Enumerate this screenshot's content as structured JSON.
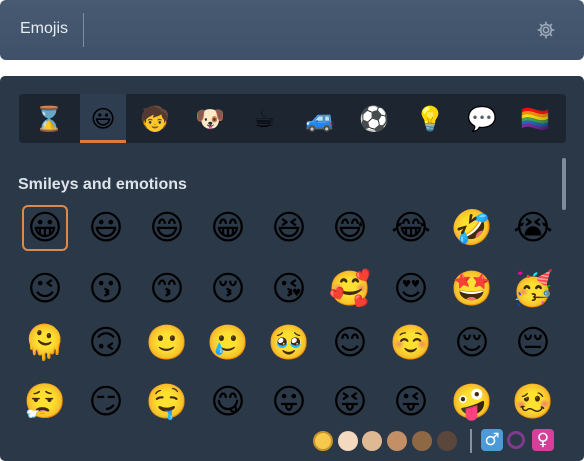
{
  "header": {
    "title": "Emojis",
    "settings_icon": "gear-icon"
  },
  "tabs": [
    {
      "name": "recent",
      "glyph": "⌛"
    },
    {
      "name": "smileys",
      "glyph": "😃",
      "active": true
    },
    {
      "name": "people",
      "glyph": "🧒"
    },
    {
      "name": "animals",
      "glyph": "🐶"
    },
    {
      "name": "food",
      "glyph": "☕"
    },
    {
      "name": "travel",
      "glyph": "🚙"
    },
    {
      "name": "activities",
      "glyph": "⚽"
    },
    {
      "name": "objects",
      "glyph": "💡"
    },
    {
      "name": "symbols",
      "glyph": "💬"
    },
    {
      "name": "flags",
      "glyph": "🏳️‍🌈"
    }
  ],
  "section": {
    "title": "Smileys and emotions"
  },
  "emojis": [
    [
      "😀",
      "😃",
      "😄",
      "😁",
      "😆",
      "😅",
      "😂",
      "🤣",
      "😭"
    ],
    [
      "😉",
      "😗",
      "😙",
      "😚",
      "😘",
      "🥰",
      "😍",
      "🤩",
      "🥳"
    ],
    [
      "🫠",
      "🙃",
      "🙂",
      "🥲",
      "🥹",
      "😊",
      "☺️",
      "😌",
      "😔"
    ],
    [
      "😮‍💨",
      "😏",
      "🤤",
      "😋",
      "😛",
      "😝",
      "😜",
      "🤪",
      "🥴"
    ]
  ],
  "skin_tones": [
    {
      "name": "default",
      "color": "#f6c84c",
      "selected": true
    },
    {
      "name": "light",
      "color": "#f3d9c0"
    },
    {
      "name": "medium-light",
      "color": "#dfb894"
    },
    {
      "name": "medium",
      "color": "#c38f66"
    },
    {
      "name": "medium-dark",
      "color": "#8e6744"
    },
    {
      "name": "dark",
      "color": "#5b463c"
    }
  ],
  "genders": [
    {
      "name": "male",
      "glyph": "♂",
      "color": "#4c9bd6"
    },
    {
      "name": "neutral",
      "glyph": "⚪",
      "color": "#7f3b8e",
      "selected": true
    },
    {
      "name": "female",
      "glyph": "♀",
      "color": "#d6409b"
    }
  ]
}
